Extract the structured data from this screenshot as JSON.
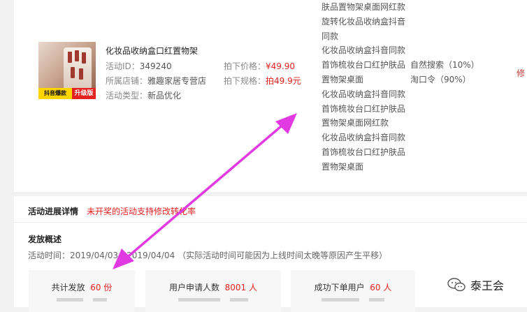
{
  "product": {
    "title": "化妆品收纳盒口红置物架",
    "badge_left": "抖音爆款",
    "badge_right": "升级版",
    "activity_id_label": "活动ID：",
    "activity_id": "349240",
    "shop_label": "所属店铺：",
    "shop": "雅趣家居专营店",
    "type_label": "活动类型：",
    "type": "新品优化",
    "price_label": "拍下价格：",
    "price": "¥49.90",
    "spec_label": "拍下规格：",
    "spec": "拍49.9元"
  },
  "keywords": [
    "肤品置物架桌面网红款",
    "旋转化妆品收纳盒抖音",
    "同款",
    "化妆品收纳盒抖音同款",
    "首饰梳妆台口红护肤品",
    "置物架桌面",
    "化妆品收纳盒抖音同款",
    "首饰梳妆台口红护肤品",
    "置物架桌面网红款",
    "化妆品收纳盒抖音同款",
    "首饰梳妆台口红护肤品",
    "置物架桌面"
  ],
  "search": {
    "natural": "自然搜索（10%）",
    "taokouling": "淘口令（90%）"
  },
  "edit_link": "修",
  "progress": {
    "heading": "活动进展详情",
    "note": "未开奖的活动支持修改转化率"
  },
  "issue": {
    "heading": "发放概述",
    "time_text": "活动时间：2019/04/03 - 2019/04/04 （实际活动时间可能因为上线时间太晚等原因产生平移）"
  },
  "stats": [
    {
      "label": "共计发放",
      "value": "60 份"
    },
    {
      "label": "用户申请人数",
      "value": "8001 人"
    },
    {
      "label": "成功下单用户",
      "value": "60 人"
    }
  ],
  "watermark": {
    "text": "泰王会"
  },
  "colors": {
    "accent_red": "#e4211f",
    "arrow_magenta": "#e23ae2"
  }
}
